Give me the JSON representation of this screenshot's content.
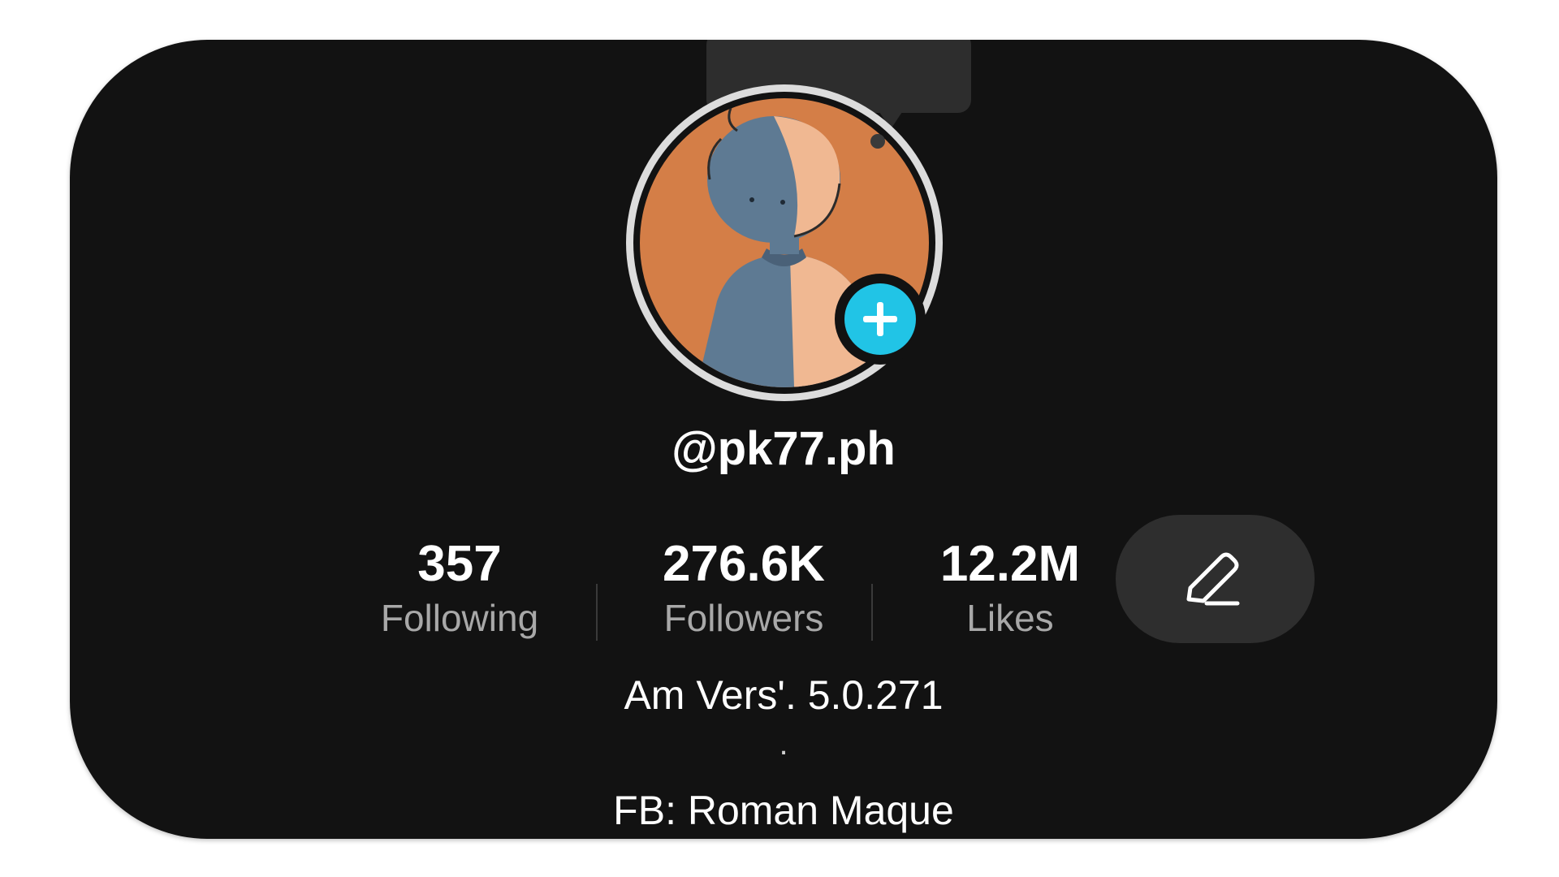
{
  "profile": {
    "username": "@pk77.ph",
    "avatar_icon": "avatar-illustration-icon",
    "add_icon": "plus-icon"
  },
  "stats": [
    {
      "value": "357",
      "label": "Following"
    },
    {
      "value": "276.6K",
      "label": "Followers"
    },
    {
      "value": "12.2M",
      "label": "Likes"
    }
  ],
  "edit_icon": "pencil-icon",
  "bio": {
    "line1": "Am Vers'. 5.0.271",
    "line2": ".",
    "line3": "FB: Roman Maque"
  },
  "colors": {
    "background": "#121212",
    "accent": "#21c4e6",
    "secondary_text": "#a8a8a8",
    "button_bg": "#2e2e2e"
  }
}
